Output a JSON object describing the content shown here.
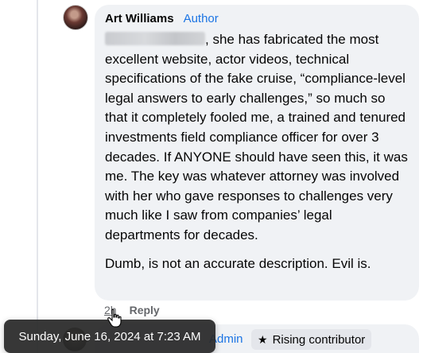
{
  "comment": {
    "author": "Art Williams",
    "badge": "Author",
    "paragraphs": [
      ", she has fabricated the most excellent website, actor videos, technical specifications of the fake cruise, “compliance-level legal answers to early challenges,” so much so that it completely fooled me, a trained and tenured investments field compliance officer for over 3 decades. If ANYONE should have seen this, it was me. The key was whatever attorney was involved with her who gave responses to challenges very much like I saw from companies’ legal departments for decades.",
      "Dumb, is not an accurate description. Evil is."
    ],
    "timestamp_short": "2h",
    "reply_label": "Reply"
  },
  "tooltip": {
    "text": "Sunday, June 16, 2024 at 7:23 AM"
  },
  "next_comment": {
    "name": "",
    "role": "Admin",
    "badge_label": "Rising contributor",
    "badge_icon": "star-icon"
  },
  "colors": {
    "bubble_bg": "#f0f2f5",
    "badge_blue": "#1b74e4",
    "muted_text": "#65676b",
    "tooltip_bg": "#282828"
  }
}
